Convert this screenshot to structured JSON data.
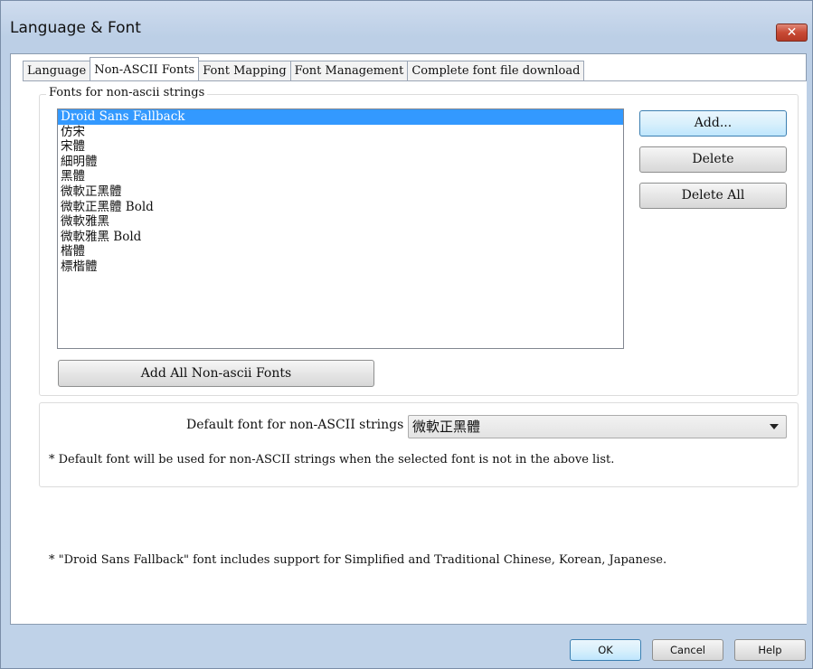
{
  "window": {
    "title": "Language & Font"
  },
  "tabs": [
    {
      "label": "Language",
      "active": false
    },
    {
      "label": "Non-ASCII Fonts",
      "active": true
    },
    {
      "label": "Font Mapping",
      "active": false
    },
    {
      "label": "Font Management",
      "active": false
    },
    {
      "label": "Complete font file download",
      "active": false
    }
  ],
  "fonts_group": {
    "label": "Fonts for non-ascii strings",
    "items": [
      "Droid Sans Fallback",
      "仿宋",
      "宋體",
      "細明體",
      "黑體",
      "微軟正黑體",
      "微軟正黑體 Bold",
      "微軟雅黑",
      "微軟雅黑 Bold",
      "楷體",
      "標楷體"
    ],
    "selected_index": 0,
    "add_label": "Add...",
    "delete_label": "Delete",
    "delete_all_label": "Delete All",
    "add_all_label": "Add All Non-ascii Fonts"
  },
  "default_font": {
    "label": "Default font for non-ASCII strings :",
    "value": "微軟正黑體",
    "note": "* Default font will be used for non-ASCII strings when the selected font is not in the above list."
  },
  "footnote": "* \"Droid Sans Fallback\" font includes support for Simplified and Traditional Chinese, Korean, Japanese.",
  "footer": {
    "ok": "OK",
    "cancel": "Cancel",
    "help": "Help"
  },
  "colors": {
    "selection": "#3399ff",
    "close_button": "#c84a35"
  }
}
